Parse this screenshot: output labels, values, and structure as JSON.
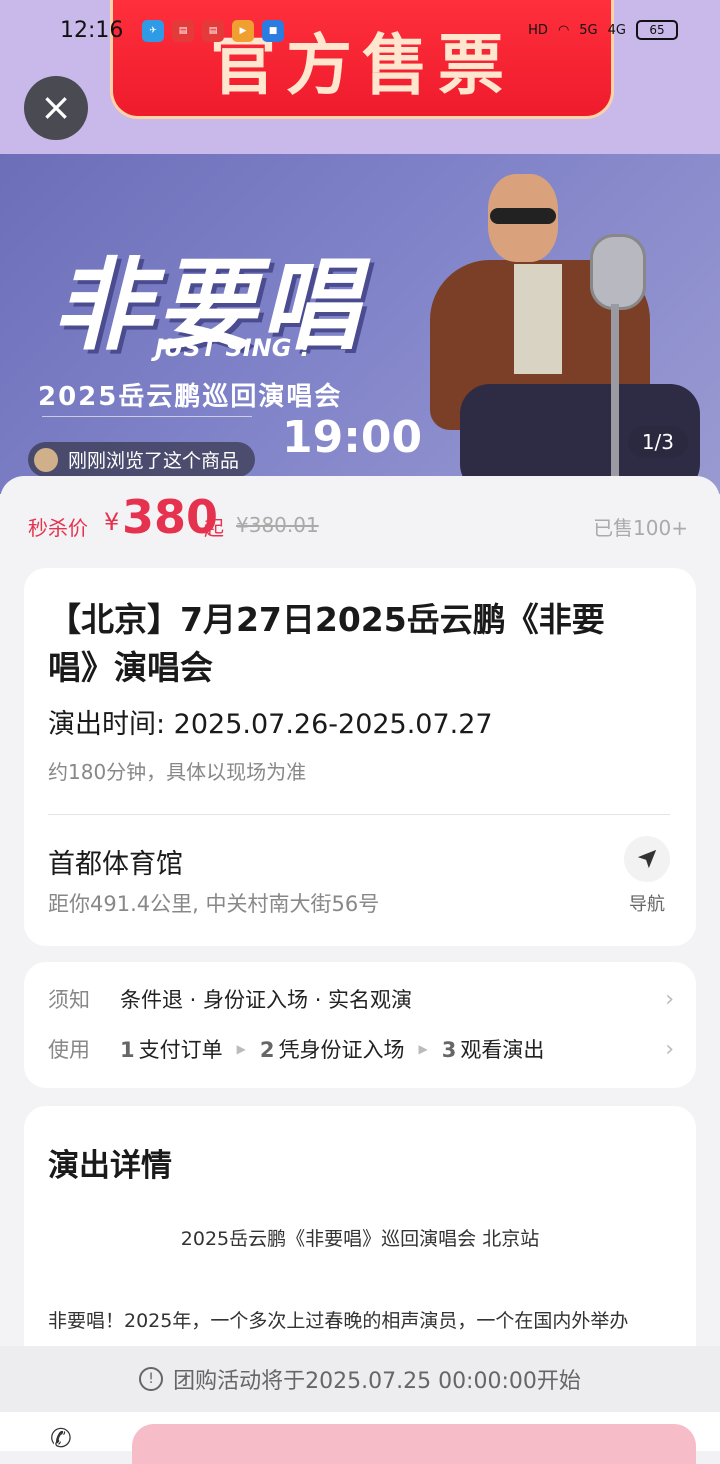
{
  "status_bar": {
    "time": "12:16",
    "network_hd": "HD",
    "network_5g": "5G",
    "network_4g": "4G",
    "battery": "65"
  },
  "banner": {
    "text": "官方售票"
  },
  "hero": {
    "title": "非要唱",
    "subtitle": "JUST SING !",
    "tour_name": "2025岳云鹏巡回演唱会",
    "time": "19:00",
    "counter": "1/3",
    "browse_badge": "刚刚浏览了这个商品"
  },
  "price": {
    "label": "秒杀价",
    "currency": "¥",
    "value": "380",
    "suffix": "起",
    "original": "¥380.01",
    "sold": "已售100+"
  },
  "event": {
    "title": "【北京】7月27日2025岳云鹏《非要唱》演唱会",
    "time": "演出时间: 2025.07.26-2025.07.27",
    "duration": "约180分钟，具体以现场为准",
    "venue_name": "首都体育馆",
    "venue_address": "距你491.4公里, 中关村南大街56号",
    "nav_label": "导航"
  },
  "rules": {
    "notice_key": "须知",
    "notice_text": "条件退 · 身份证入场 · 实名观演",
    "usage_key": "使用",
    "steps": [
      {
        "num": "1",
        "label": "支付订单"
      },
      {
        "num": "2",
        "label": "凭身份证入场"
      },
      {
        "num": "3",
        "label": "观看演出"
      }
    ]
  },
  "details": {
    "heading": "演出详情",
    "sub": "2025岳云鹏《非要唱》巡回演唱会 北京站",
    "body": "非要唱！2025年，一个多次上过春晚的相声演员，一个在国内外举办"
  },
  "notice_bar": {
    "text": "团购活动将于2025.07.25 00:00:00开始"
  },
  "colors": {
    "accent": "#e5324f",
    "banner": "#ee1b2c",
    "top_band": "#c8b9ea"
  }
}
